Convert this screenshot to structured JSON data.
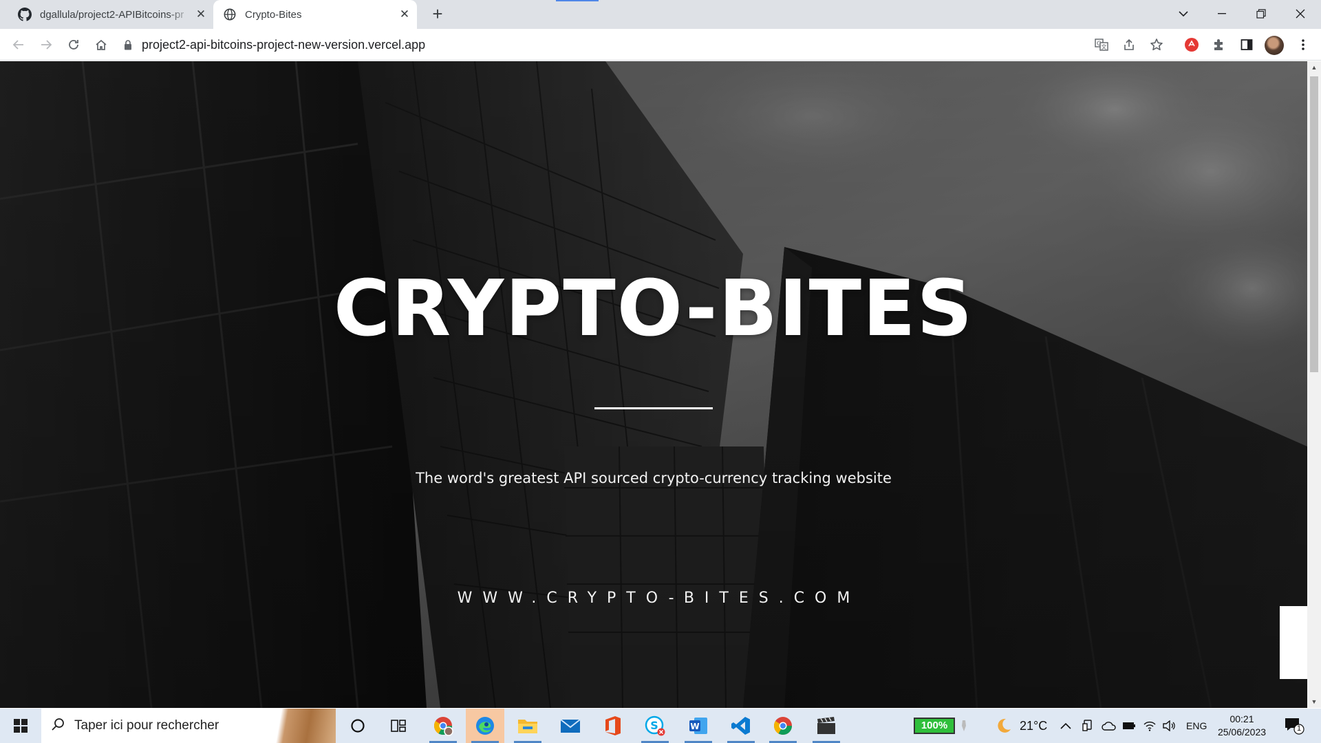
{
  "browser": {
    "tabs": [
      {
        "title": "dgallula/project2-APIBitcoins-pr",
        "favicon": "github-icon",
        "active": false
      },
      {
        "title": "Crypto-Bites",
        "favicon": "globe-icon",
        "active": true
      }
    ],
    "url": "project2-api-bitcoins-project-new-version.vercel.app"
  },
  "page": {
    "title": "CRYPTO-BITES",
    "subtitle": "The word's greatest API sourced crypto-currency tracking website",
    "site": "WWW.CRYPTO-BITES.COM"
  },
  "taskbar": {
    "search_placeholder": "Taper ici pour rechercher",
    "apps": [
      "cortana-icon",
      "task-view-icon",
      "chrome-profile-icon",
      "edge-icon",
      "file-explorer-icon",
      "mail-icon",
      "office-icon",
      "skype-icon",
      "word-icon",
      "vscode-icon",
      "chrome-icon",
      "clapper-icon"
    ],
    "battery": "100%",
    "temperature": "21°C",
    "language": "ENG",
    "time": "00:21",
    "date": "25/06/2023",
    "notifications": "1"
  },
  "colors": {
    "tabstrip": "#dee1e6",
    "taskbar": "#dfe8f3",
    "battery_fill": "#2fbf3b",
    "hero_text": "#ffffff"
  }
}
